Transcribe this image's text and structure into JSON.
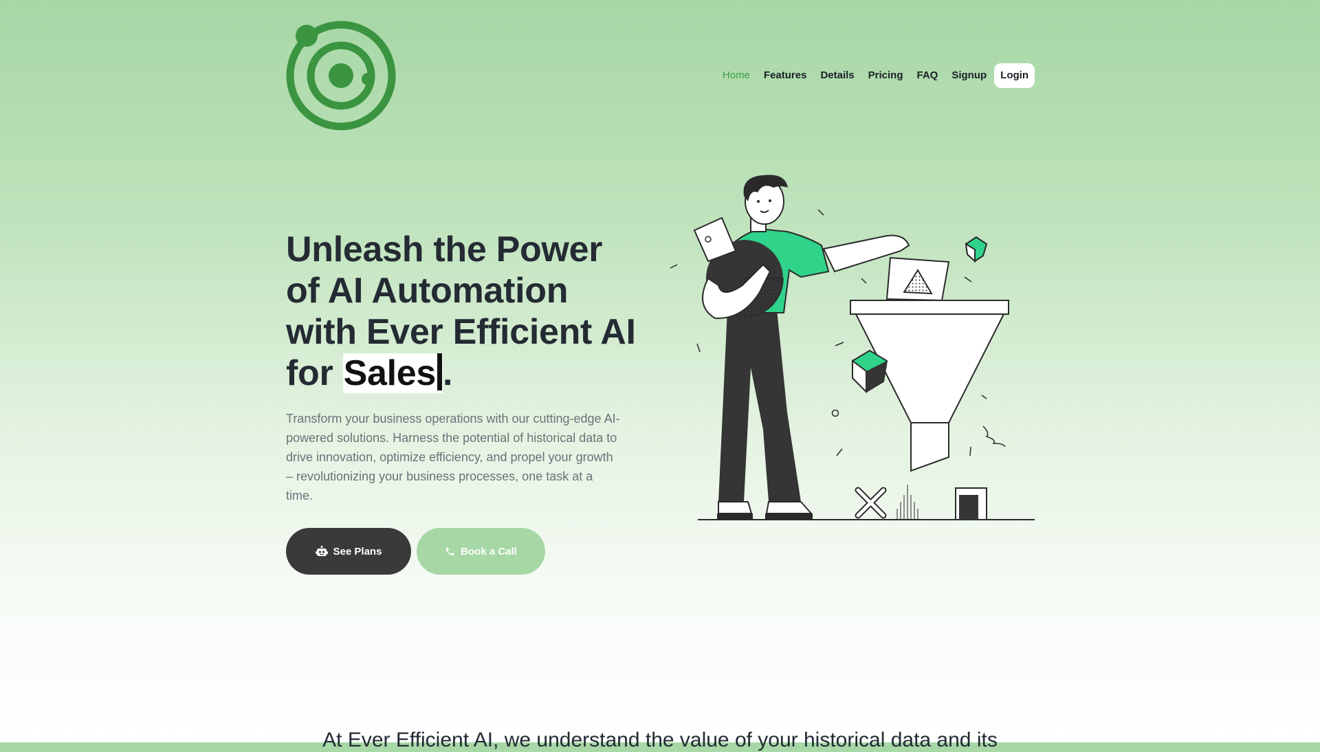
{
  "brand": {
    "logo_icon": "orbit-target-logo-icon",
    "color": "#3a9440"
  },
  "nav": {
    "items": [
      {
        "label": "Home",
        "active": true
      },
      {
        "label": "Features"
      },
      {
        "label": "Details"
      },
      {
        "label": "Pricing"
      },
      {
        "label": "FAQ"
      },
      {
        "label": "Signup"
      },
      {
        "label": "Login"
      }
    ]
  },
  "hero": {
    "title_lead": "Unleash the Power of AI Automation with Ever Efficient AI for ",
    "title_typed": "Sales",
    "title_end": ".",
    "description": "Transform your business operations with our cutting-edge AI-powered solutions. Harness the potential of historical data to drive innovation, optimize efficiency, and propel your growth – revolutionizing your business processes, one task at a time.",
    "primary_button": {
      "label": "See Plans",
      "icon": "robot-icon"
    },
    "secondary_button": {
      "label": "Book a Call",
      "icon": "phone-icon"
    },
    "illustration": "man-feeding-data-into-funnel-illustration"
  },
  "intro": {
    "text": "At Ever Efficient AI, we understand the value of your historical data and its"
  },
  "colors": {
    "accent_green": "#2fd38a",
    "dark": "#3a3a3a",
    "light_green": "#a6d7a5"
  }
}
